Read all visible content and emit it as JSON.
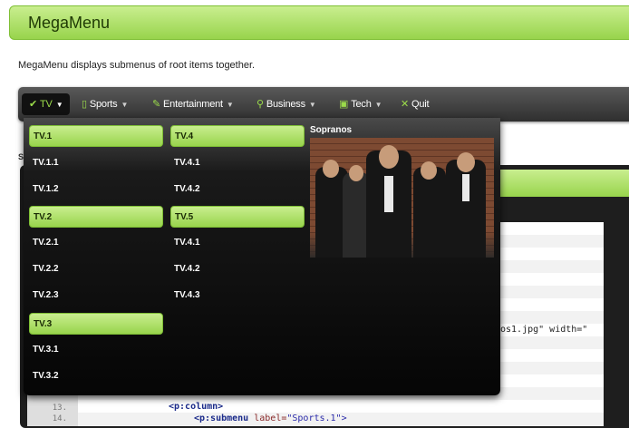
{
  "page": {
    "title": "MegaMenu",
    "description": "MegaMenu displays submenus of root items together."
  },
  "menubar": {
    "items": [
      {
        "label": "TV",
        "icon": "check-icon"
      },
      {
        "label": "Sports",
        "icon": "document-icon"
      },
      {
        "label": "Entertainment",
        "icon": "pencil-icon"
      },
      {
        "label": "Business",
        "icon": "search-icon"
      },
      {
        "label": "Tech",
        "icon": "monitor-icon"
      },
      {
        "label": "Quit",
        "icon": "close-icon"
      }
    ]
  },
  "megamenu": {
    "col1": [
      "TV.1",
      "TV.1.1",
      "TV.1.2",
      "TV.2",
      "TV.2.1",
      "TV.2.2",
      "TV.2.3",
      "TV.3",
      "TV.3.1",
      "TV.3.2"
    ],
    "col2": [
      "TV.4",
      "TV.4.1",
      "TV.4.2",
      "TV.5",
      "TV.4.1",
      "TV.4.2",
      "TV.4.3"
    ],
    "promo_title": "Sopranos"
  },
  "background": {
    "stray": "S",
    "line_13": "13.",
    "line_14": "14.",
    "code_13": "<p:column>",
    "code_14_tag": "<p:submenu ",
    "code_14_attr": "label=",
    "code_14_str": "\"Sports.1\">",
    "code_partial": "os1.jpg\" width=\""
  },
  "colors": {
    "accent": "#98d44c",
    "menubar": "#3a3a3a"
  }
}
